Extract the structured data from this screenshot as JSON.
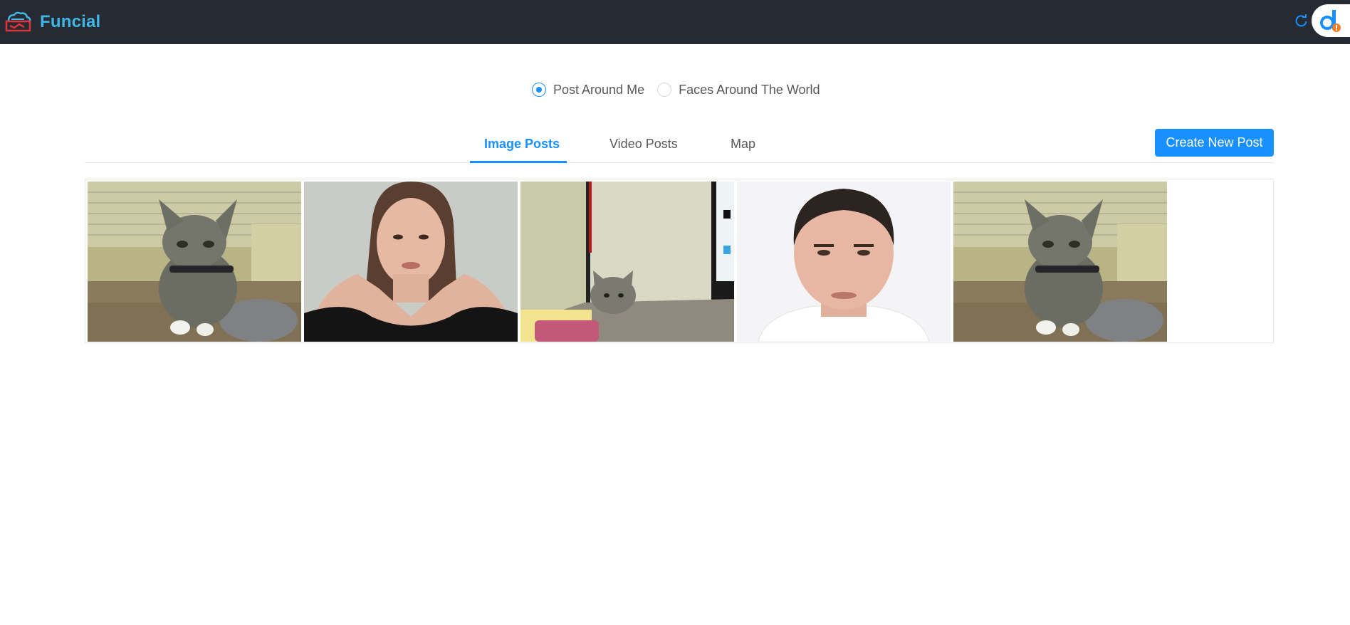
{
  "header": {
    "app_title": "Funcial",
    "logo_icon": "funcial-logo-icon",
    "refresh_icon": "refresh-icon",
    "avatar_icon": "user-avatar-icon",
    "brand_color": "#40b6e6",
    "bar_color": "#262a33"
  },
  "radio": {
    "options": [
      {
        "label": "Post Around Me",
        "checked": true
      },
      {
        "label": "Faces Around The World",
        "checked": false
      }
    ]
  },
  "tabs": {
    "items": [
      {
        "label": "Image Posts",
        "active": true
      },
      {
        "label": "Video Posts",
        "active": false
      },
      {
        "label": "Map",
        "active": false
      }
    ],
    "accent": "#1890ff"
  },
  "actions": {
    "create_label": "Create New Post"
  },
  "gallery": {
    "images": [
      {
        "subject": "kitten-photo"
      },
      {
        "subject": "woman-portrait-photo"
      },
      {
        "subject": "kitten-by-monitor-photo"
      },
      {
        "subject": "man-portrait-photo"
      },
      {
        "subject": "kitten-photo"
      }
    ]
  }
}
